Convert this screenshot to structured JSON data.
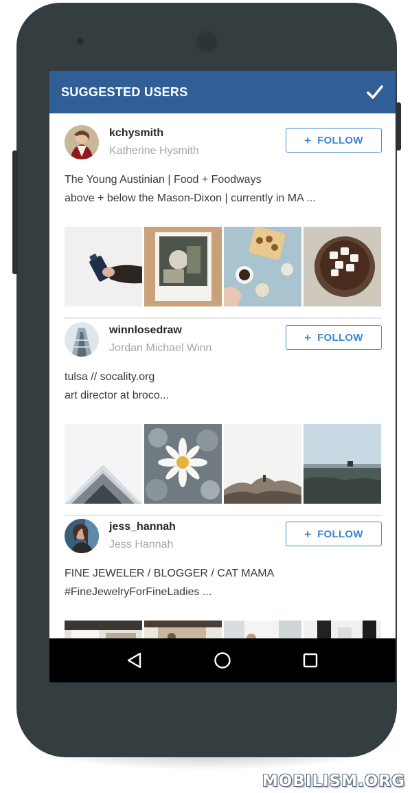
{
  "header": {
    "title": "SUGGESTED USERS",
    "confirm_icon": "check-icon"
  },
  "colors": {
    "header_bg": "#2f5f96",
    "follow_accent": "#3f86d3",
    "phone_body": "#343d40"
  },
  "users": [
    {
      "username": "kchysmith",
      "full_name": "Katherine Hysmith",
      "follow_plus": "+",
      "follow_label": "FOLLOW",
      "bio_line1": "The Young Austinian | Food + Foodways",
      "bio_line2": "above + below the Mason-Dixon | currently in MA ..."
    },
    {
      "username": "winnlosedraw",
      "full_name": "Jordan Michael Winn",
      "follow_plus": "+",
      "follow_label": "FOLLOW",
      "bio_line1": "tulsa // socality.org",
      "bio_line2": "art director at broco..."
    },
    {
      "username": "jess_hannah",
      "full_name": "Jess Hannah",
      "follow_plus": "+",
      "follow_label": "FOLLOW",
      "bio_line1": "FINE JEWELER / BLOGGER / CAT MAMA",
      "bio_line2": "#FineJewelryForFineLadies ..."
    }
  ],
  "nav": {
    "back_icon": "back-triangle-icon",
    "home_icon": "home-circle-icon",
    "recents_icon": "recents-square-icon"
  },
  "watermark": "MOBILISM.ORG"
}
